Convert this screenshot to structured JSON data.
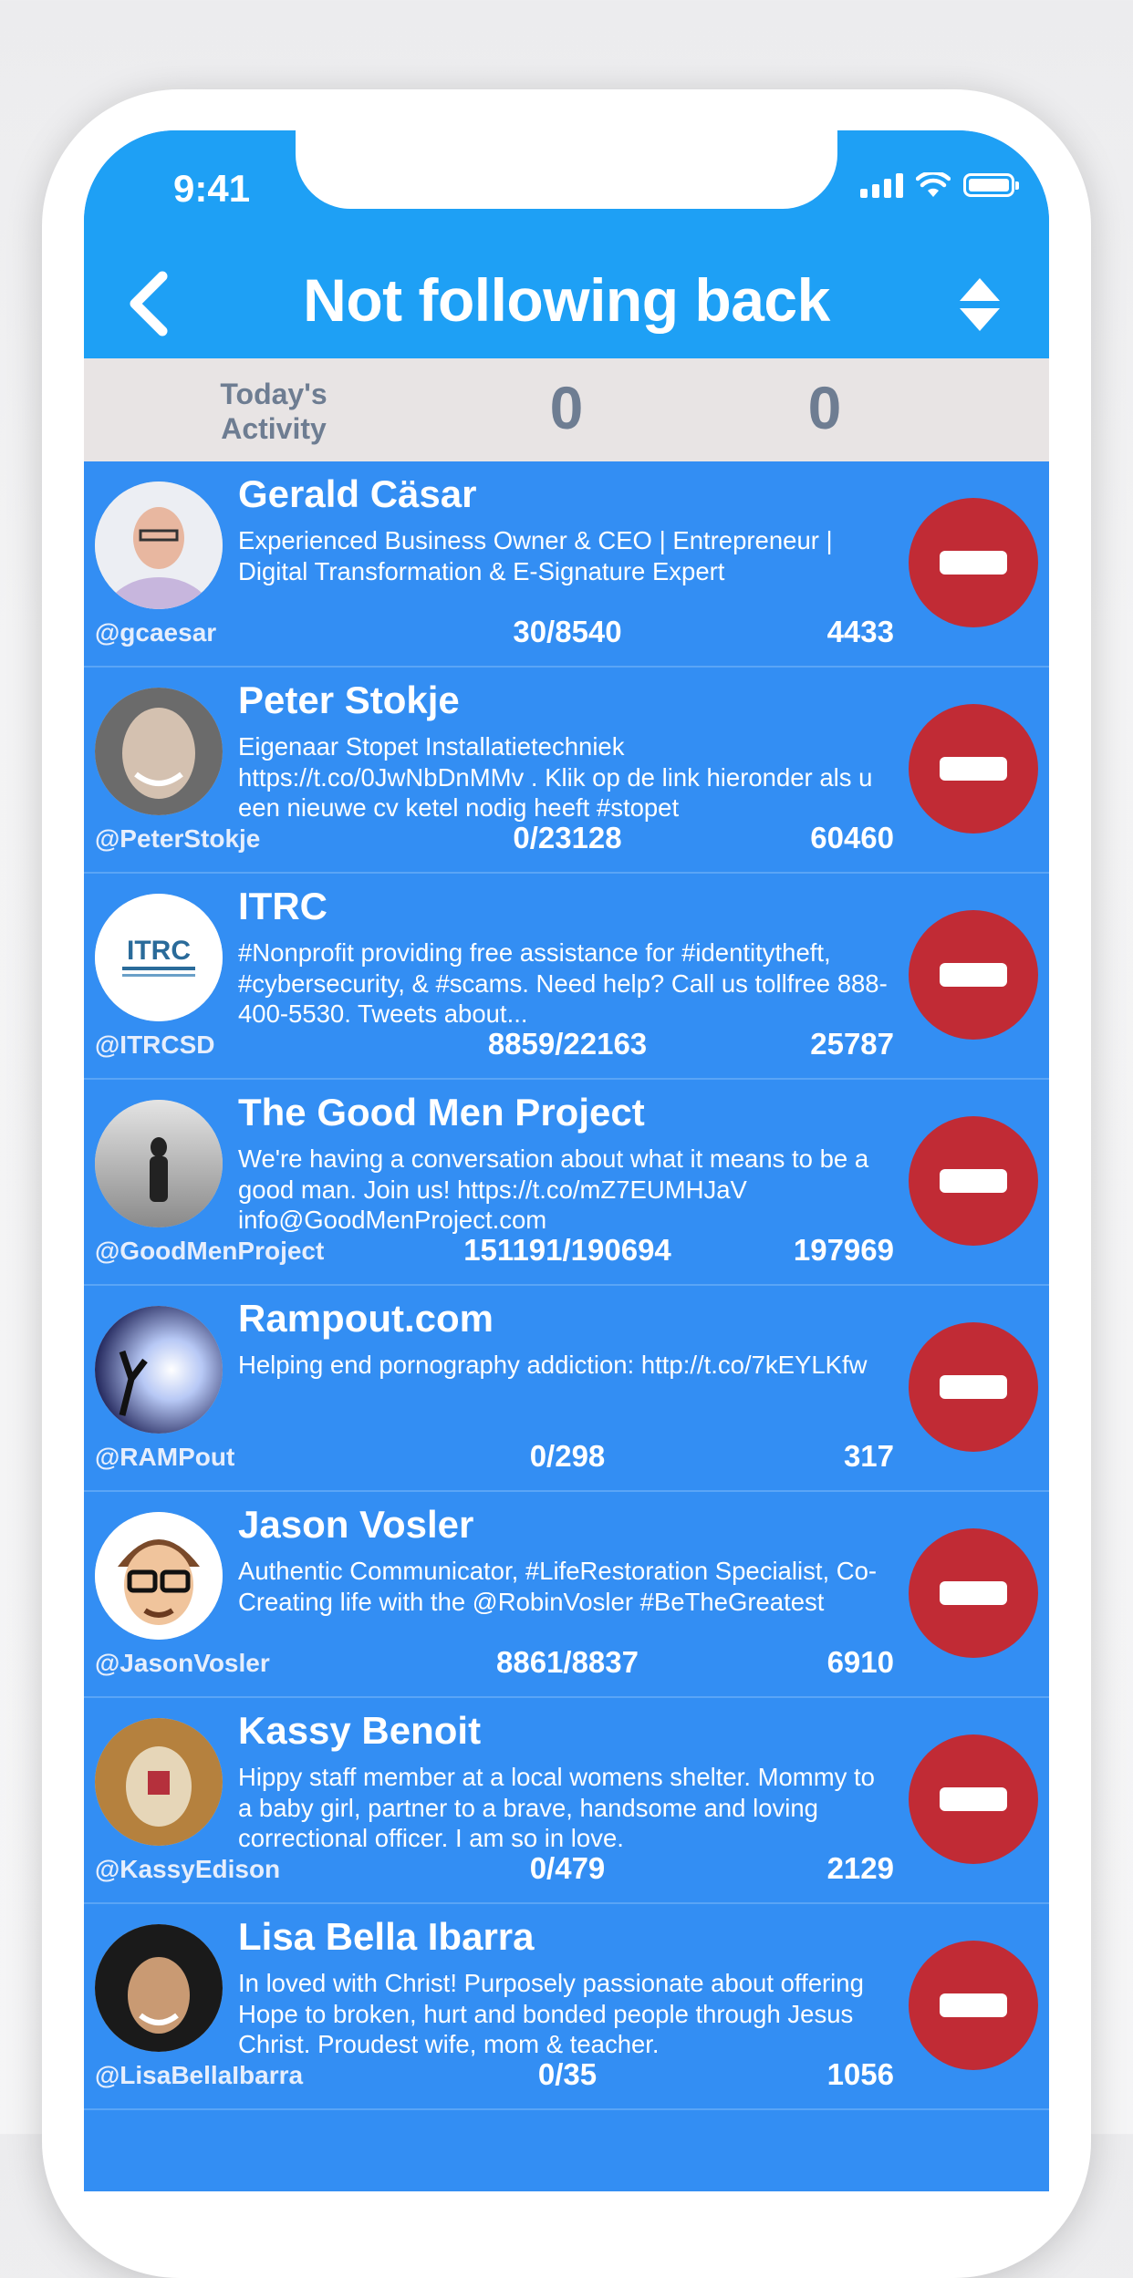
{
  "status_bar": {
    "time": "9:41"
  },
  "header": {
    "title": "Not following back"
  },
  "activity": {
    "label": "Today's Activity",
    "value_a": "0",
    "value_b": "0"
  },
  "users": [
    {
      "name": "Gerald Cäsar",
      "bio": "Experienced Business Owner & CEO | Entrepreneur | Digital Transformation & E-Signature Expert",
      "handle": "@gcaesar",
      "ratio": "30/8540",
      "count": "4433"
    },
    {
      "name": "Peter Stokje",
      "bio": "Eigenaar Stopet Installatietechniek   https://t.co/0JwNbDnMMv .  Klik op de link hieronder als u een nieuwe cv ketel nodig heeft #stopet",
      "handle": "@PeterStokje",
      "ratio": "0/23128",
      "count": "60460"
    },
    {
      "name": "ITRC",
      "bio": "#Nonprofit providing free assistance for #identitytheft, #cybersecurity, & #scams. Need help? Call us tollfree 888-400-5530. Tweets about...",
      "handle": "@ITRCSD",
      "ratio": "8859/22163",
      "count": "25787",
      "avatar_text": "ITRC"
    },
    {
      "name": "The Good Men Project",
      "bio": "We're having a conversation about what it means to be a good man. Join us! https://t.co/mZ7EUMHJaV info@GoodMenProject.com",
      "handle": "@GoodMenProject",
      "ratio": "151191/190694",
      "count": "197969"
    },
    {
      "name": "Rampout.com",
      "bio": "Helping end pornography addiction: http://t.co/7kEYLKfw",
      "handle": "@RAMPout",
      "ratio": "0/298",
      "count": "317"
    },
    {
      "name": "Jason Vosler",
      "bio": "Authentic Communicator, #LifeRestoration Specialist, Co-Creating life with the @RobinVosler #BeTheGreatest",
      "handle": "@JasonVosler",
      "ratio": "8861/8837",
      "count": "6910"
    },
    {
      "name": "Kassy Benoit",
      "bio": "Hippy staff member at a local womens shelter. Mommy to a baby girl, partner to a brave, handsome and loving correctional officer. I am so in love.",
      "handle": "@KassyEdison",
      "ratio": "0/479",
      "count": "2129"
    },
    {
      "name": "Lisa Bella Ibarra",
      "bio": "In loved with Christ! Purposely passionate about offering Hope to broken, hurt and bonded people through Jesus Christ. Proudest wife, mom & teacher.",
      "handle": "@LisaBellaIbarra",
      "ratio": "0/35",
      "count": "1056"
    }
  ],
  "colors": {
    "header_blue": "#1ea0f5",
    "list_blue": "#338ef3",
    "remove_red": "#c12b35",
    "activity_bg": "#e8e4e4"
  }
}
